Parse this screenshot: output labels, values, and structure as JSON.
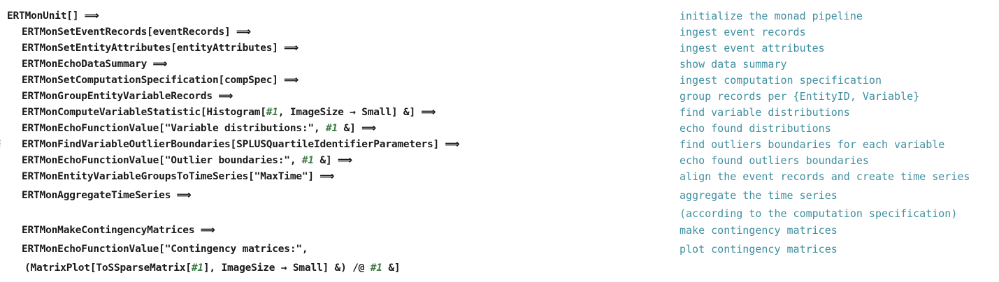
{
  "code_lines": [
    {
      "id": "l0",
      "text": "ERTMonUnit[] ⟹"
    },
    {
      "id": "l1",
      "text": "ERTMonSetEventRecords[eventRecords] ⟹"
    },
    {
      "id": "l2",
      "text": "ERTMonSetEntityAttributes[entityAttributes] ⟹"
    },
    {
      "id": "l3",
      "text": "ERTMonEchoDataSummary ⟹"
    },
    {
      "id": "l4",
      "text": "ERTMonSetComputationSpecification[compSpec] ⟹"
    },
    {
      "id": "l5",
      "text": "ERTMonGroupEntityVariableRecords ⟹"
    },
    {
      "id": "l6a",
      "text": "ERTMonComputeVariableStatistic[Histogram["
    },
    {
      "id": "l6s",
      "text": "#1"
    },
    {
      "id": "l6b",
      "text": ", ImageSize → Small] &] ⟹"
    },
    {
      "id": "l7a",
      "text": "ERTMonEchoFunctionValue[\"Variable distributions:\", "
    },
    {
      "id": "l7s",
      "text": "#1"
    },
    {
      "id": "l7b",
      "text": " &] ⟹"
    },
    {
      "id": "l8",
      "text": "ERTMonFindVariableOutlierBoundaries[SPLUSQuartileIdentifierParameters] ⟹"
    },
    {
      "id": "l9a",
      "text": "ERTMonEchoFunctionValue[\"Outlier boundaries:\", "
    },
    {
      "id": "l9s",
      "text": "#1"
    },
    {
      "id": "l9b",
      "text": " &] ⟹"
    },
    {
      "id": "l10",
      "text": "ERTMonEntityVariableGroupsToTimeSeries[\"MaxTime\"] ⟹"
    },
    {
      "id": "l11",
      "text": "ERTMonAggregateTimeSeries ⟹"
    },
    {
      "id": "l12",
      "text": "ERTMonMakeContingencyMatrices ⟹"
    },
    {
      "id": "l13",
      "text": "ERTMonEchoFunctionValue[\"Contingency matrices:\","
    },
    {
      "id": "l14a",
      "text": "(MatrixPlot[ToSSparseMatrix["
    },
    {
      "id": "l14s",
      "text": "#1"
    },
    {
      "id": "l14b",
      "text": "], ImageSize → Small] &) /@ "
    },
    {
      "id": "l14t",
      "text": "#1"
    },
    {
      "id": "l14c",
      "text": " &]"
    }
  ],
  "comments": [
    "initialize the monad pipeline",
    "ingest event records",
    "ingest event attributes",
    "show data summary",
    "ingest computation specification",
    "group records per {EntityID, Variable}",
    "find variable distributions",
    "echo found distributions",
    "find outliers boundaries for each variable",
    "echo found outliers boundaries",
    "align the event records and create time series",
    "aggregate the time series",
    "(according to the computation specification)",
    "make contingency matrices",
    "plot contingency matrices"
  ]
}
